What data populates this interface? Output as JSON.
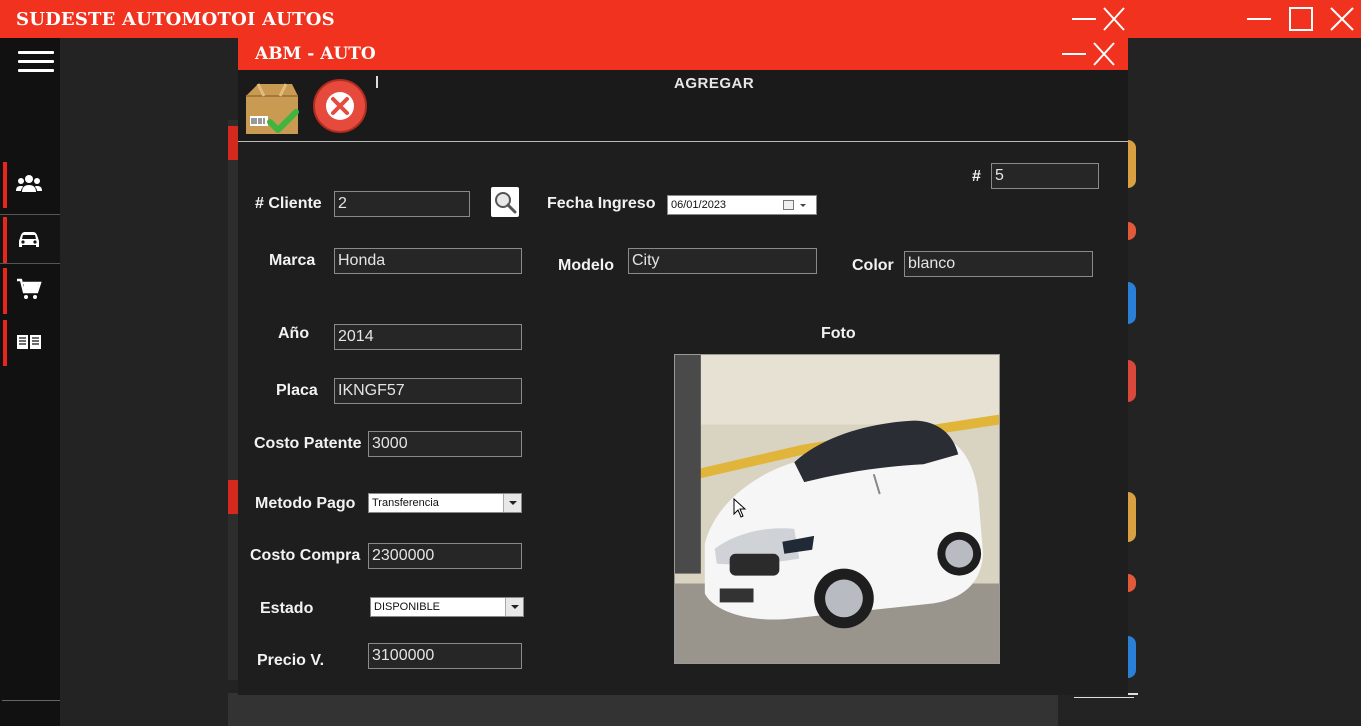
{
  "app": {
    "title": "SUDESTE  AUTOMOTOR AUTOS",
    "title_display": "SUDESTE  AUTOMOTOI  AUTOS",
    "accent_color": "#f0321e"
  },
  "sidebar": {
    "items": [
      {
        "icon": "users-icon",
        "active": false
      },
      {
        "icon": "car-icon",
        "active": true
      },
      {
        "icon": "cart-icon",
        "active": false
      },
      {
        "icon": "book-icon",
        "active": false
      }
    ]
  },
  "dialog": {
    "title": "ABM - AUTO",
    "mode": "AGREGAR",
    "id_label": "#",
    "id_value": "5",
    "fields": {
      "cliente": {
        "label": "# Cliente",
        "value": "2"
      },
      "fecha_ingreso": {
        "label": "Fecha Ingreso",
        "value": "06/01/2023"
      },
      "marca": {
        "label": "Marca",
        "value": "Honda"
      },
      "modelo": {
        "label": "Modelo",
        "value": "City"
      },
      "color": {
        "label": "Color",
        "value": "blanco"
      },
      "anio": {
        "label": "Año",
        "value": "2014"
      },
      "placa": {
        "label": "Placa",
        "value": "IKNGF57"
      },
      "costo_patente": {
        "label": "Costo Patente",
        "value": "3000"
      },
      "metodo_pago": {
        "label": "Metodo Pago",
        "value": "Transferencia"
      },
      "costo_compra": {
        "label": "Costo Compra",
        "value": "2300000"
      },
      "estado": {
        "label": "Estado",
        "value": "DISPONIBLE"
      },
      "precio_v": {
        "label": "Precio V.",
        "value": "3100000"
      }
    },
    "foto_label": "Foto"
  }
}
